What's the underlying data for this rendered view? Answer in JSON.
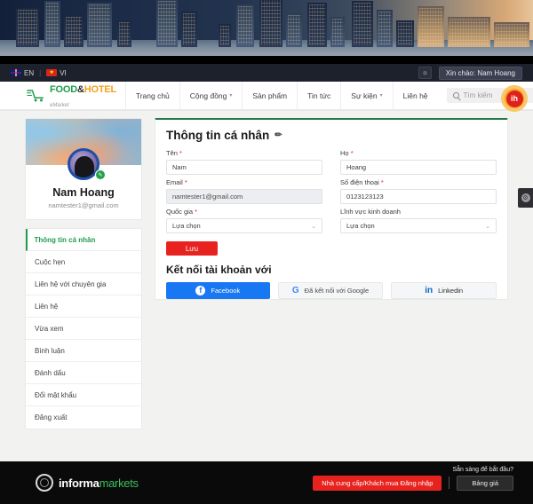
{
  "langbar": {
    "en_label": "EN",
    "vi_label": "VI",
    "separator": "|",
    "bell_icon": "ὑ4",
    "greeting": "Xin chào: Nam Hoang"
  },
  "header": {
    "logo": {
      "food": "FOOD",
      "amp": "&",
      "hotel": "HOTEL",
      "sub": "eMarket"
    },
    "nav": [
      {
        "label": "Trang chủ",
        "has_caret": false
      },
      {
        "label": "Cộng đồng",
        "has_caret": true
      },
      {
        "label": "Sản phẩm",
        "has_caret": false
      },
      {
        "label": "Tin tức",
        "has_caret": false
      },
      {
        "label": "Sự kiện",
        "has_caret": true
      },
      {
        "label": "Liên hệ",
        "has_caret": false
      }
    ],
    "search_placeholder": "Tìm kiếm",
    "badge_text": "ih"
  },
  "sidebar": {
    "profile": {
      "name": "Nam Hoang",
      "email": "namtester1@gmail.com"
    },
    "items": [
      {
        "label": "Thông tin cá nhân",
        "active": true
      },
      {
        "label": "Cuộc hẹn",
        "active": false
      },
      {
        "label": "Liên hệ với chuyên gia",
        "active": false
      },
      {
        "label": "Liên hệ",
        "active": false
      },
      {
        "label": "Vừa xem",
        "active": false
      },
      {
        "label": "Bình luận",
        "active": false
      },
      {
        "label": "Đánh dấu",
        "active": false
      },
      {
        "label": "Đổi mật khẩu",
        "active": false
      },
      {
        "label": "Đăng xuất",
        "active": false
      }
    ]
  },
  "main": {
    "title": "Thông tin cá nhân",
    "edit_icon": "✏",
    "fields": {
      "first_name": {
        "label": "Tên",
        "required": true,
        "value": "Nam"
      },
      "last_name": {
        "label": "Họ",
        "required": true,
        "value": "Hoang"
      },
      "email": {
        "label": "Email",
        "required": true,
        "value": "namtester1@gmail.com",
        "readonly": true
      },
      "phone": {
        "label": "Số điện thoại",
        "required": true,
        "value": "0123123123"
      },
      "country": {
        "label": "Quốc gia",
        "required": true,
        "value": "Lựa chọn"
      },
      "business": {
        "label": "Lĩnh vực kinh doanh",
        "required": false,
        "value": "Lựa chọn"
      }
    },
    "save_label": "Lưu",
    "connect_title": "Kết nối tài khoản với",
    "social": [
      {
        "label": "Facebook",
        "icon": "f",
        "style": "fb"
      },
      {
        "label": "Đã kết nối với Google",
        "icon": "G",
        "style": "gg"
      },
      {
        "label": "Linkedin",
        "icon": "in",
        "style": "li"
      }
    ]
  },
  "side_tab": {
    "icon": "gear-icon"
  },
  "footer": {
    "logo_a": "informa",
    "logo_b": "markets",
    "ready_text": "Sẵn sàng để bắt đầu?",
    "primary_label": "Nhà cung cấp/Khách mua Đăng nhập",
    "secondary_label": "Bảng giá"
  },
  "colors": {
    "brand_green": "#1f9d4d",
    "brand_orange": "#f5a01e",
    "accent_red": "#e8231f",
    "facebook_blue": "#1877f2",
    "linkedin_blue": "#0a66c2"
  }
}
